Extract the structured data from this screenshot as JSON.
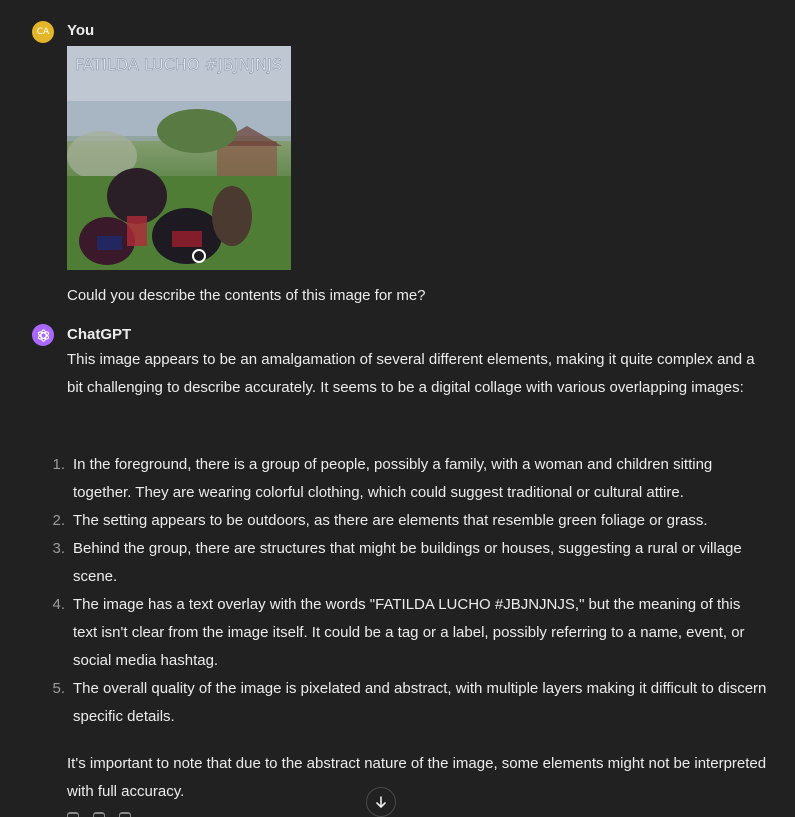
{
  "user_message": {
    "avatar_initials": "CA",
    "author": "You",
    "attached_image_overlay_text": "FATILDA LUCHO #JBJNJNJS",
    "text": "Could you describe the contents of this image for me?"
  },
  "assistant_message": {
    "author": "ChatGPT",
    "avatar_icon": "openai-logo-icon",
    "intro": "This image appears to be an amalgamation of several different elements, making it quite complex and a bit challenging to describe accurately. It seems to be a digital collage with various overlapping images:",
    "list": [
      {
        "num": "1.",
        "text": "In the foreground, there is a group of people, possibly a family, with a woman and children sitting together. They are wearing colorful clothing, which could suggest traditional or cultural attire."
      },
      {
        "num": "2.",
        "text": "The setting appears to be outdoors, as there are elements that resemble green foliage or grass."
      },
      {
        "num": "3.",
        "text": "Behind the group, there are structures that might be buildings or houses, suggesting a rural or village scene."
      },
      {
        "num": "4.",
        "text": "The image has a text overlay with the words \"FATILDA LUCHO #JBJNJNJS,\" but the meaning of this text isn't clear from the image itself. It could be a tag or a label, possibly referring to a name, event, or social media hashtag."
      },
      {
        "num": "5.",
        "text": "The overall quality of the image is pixelated and abstract, with multiple layers making it difficult to discern specific details."
      }
    ],
    "outro": "It's important to note that due to the abstract nature of the image, some elements might not be interpreted with full accuracy."
  },
  "controls": {
    "scroll_down_icon": "arrow-down-icon"
  },
  "colors": {
    "background": "#212121",
    "text": "#ececec",
    "user_avatar": "#e3b528",
    "assistant_avatar": "#ab68ff",
    "list_number": "#9b9b9b"
  }
}
